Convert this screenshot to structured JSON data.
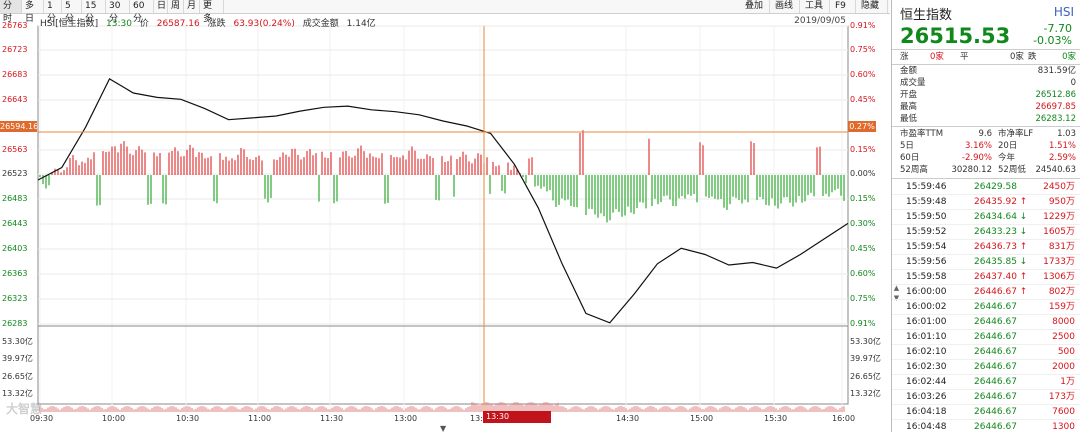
{
  "toolbar": {
    "left_buttons": [
      "分时",
      "多日",
      "1分",
      "5分",
      "15分",
      "30分",
      "60分",
      "日",
      "周",
      "月",
      "更多"
    ],
    "right_buttons": [
      "叠加",
      "画线",
      "工具",
      "F9",
      "隐藏"
    ]
  },
  "chart_header": {
    "symbol": "HSI[恒生指数]",
    "time": "13:30",
    "price_label": "价",
    "price": "26587.16",
    "change_label": "涨跌",
    "change": "63.93(0.24%)",
    "turnover_label": "成交金额",
    "turnover": "1.14亿",
    "date": "2019/09/05"
  },
  "y_axis_price": [
    "26763",
    "26723",
    "26683",
    "26643",
    "26563",
    "26523",
    "26483",
    "26443",
    "26403",
    "26363",
    "26323",
    "26283"
  ],
  "y_axis_pct": [
    "0.91%",
    "0.75%",
    "0.60%",
    "0.45%",
    "0.15%",
    "0.00%",
    "0.15%",
    "0.30%",
    "0.45%",
    "0.60%",
    "0.75%",
    "0.91%"
  ],
  "crosshair": {
    "price": "26594.16",
    "pct": "0.27%",
    "time": "13:30"
  },
  "volume_axis": [
    "53.30亿",
    "39.97亿",
    "26.65亿",
    "13.32亿"
  ],
  "x_axis": [
    "09:30",
    "10:00",
    "10:30",
    "11:00",
    "11:30",
    "13:00",
    "13:30",
    "14:30",
    "15:00",
    "15:30",
    "16:00"
  ],
  "watermark": "大智慧",
  "quote": {
    "name": "恒生指数",
    "code": "HSI",
    "price": "26515.53",
    "change": "-7.70",
    "change_pct": "-0.03%",
    "bid_ask": {
      "left_label": "涨",
      "left_value": "0家",
      "mid_label": "平",
      "right_value": "0家",
      "right_label": "跌",
      "far_value": "0家"
    },
    "stats": [
      {
        "label": "金额",
        "value": "831.59亿"
      },
      {
        "label": "成交量",
        "value": "0"
      },
      {
        "label": "开盘",
        "value": "26512.86"
      },
      {
        "label": "最高",
        "value": "26697.85"
      },
      {
        "label": "最低",
        "value": "26283.12"
      }
    ],
    "ratios": [
      {
        "l1": "市盈率TTM",
        "v1": "9.6",
        "l2": "市净率LF",
        "v2": "1.03"
      },
      {
        "l1": "5日",
        "v1": "3.16%",
        "l2": "20日",
        "v2": "1.51%"
      },
      {
        "l1": "60日",
        "v1": "-2.90%",
        "l2": "今年",
        "v2": "2.59%"
      },
      {
        "l1": "52周高",
        "v1": "30280.12",
        "l2": "52周低",
        "v2": "24540.63"
      }
    ]
  },
  "ticks": [
    {
      "time": "15:59:46",
      "price": "26429.58",
      "dir": "",
      "vol": "2450万"
    },
    {
      "time": "15:59:48",
      "price": "26435.92",
      "dir": "up",
      "vol": "950万"
    },
    {
      "time": "15:59:50",
      "price": "26434.64",
      "dir": "down",
      "vol": "1229万"
    },
    {
      "time": "15:59:52",
      "price": "26433.23",
      "dir": "down",
      "vol": "1605万"
    },
    {
      "time": "15:59:54",
      "price": "26436.73",
      "dir": "up",
      "vol": "831万"
    },
    {
      "time": "15:59:56",
      "price": "26435.85",
      "dir": "down",
      "vol": "1733万"
    },
    {
      "time": "15:59:58",
      "price": "26437.40",
      "dir": "up",
      "vol": "1306万"
    },
    {
      "time": "16:00:00",
      "price": "26446.67",
      "dir": "up",
      "vol": "802万"
    },
    {
      "time": "16:00:02",
      "price": "26446.67",
      "dir": "",
      "vol": "159万"
    },
    {
      "time": "16:01:00",
      "price": "26446.67",
      "dir": "",
      "vol": "8000"
    },
    {
      "time": "16:01:10",
      "price": "26446.67",
      "dir": "",
      "vol": "2500"
    },
    {
      "time": "16:02:10",
      "price": "26446.67",
      "dir": "",
      "vol": "500"
    },
    {
      "time": "16:02:30",
      "price": "26446.67",
      "dir": "",
      "vol": "2000"
    },
    {
      "time": "16:02:44",
      "price": "26446.67",
      "dir": "",
      "vol": "1万"
    },
    {
      "time": "16:03:26",
      "price": "26446.67",
      "dir": "",
      "vol": "173万"
    },
    {
      "time": "16:04:18",
      "price": "26446.67",
      "dir": "",
      "vol": "7600"
    },
    {
      "time": "16:04:48",
      "price": "26446.67",
      "dir": "",
      "vol": "1300"
    }
  ],
  "chart_data": {
    "type": "line",
    "title": "HSI[恒生指数]",
    "xlabel": "",
    "ylabel": "",
    "prev_close": 26523,
    "ylim": [
      26283,
      26763
    ],
    "x": [
      "09:30",
      "09:40",
      "09:50",
      "10:00",
      "10:10",
      "10:20",
      "10:30",
      "10:40",
      "10:50",
      "11:00",
      "11:10",
      "11:20",
      "11:30",
      "11:40",
      "11:50",
      "12:00",
      "13:00",
      "13:10",
      "13:20",
      "13:30",
      "13:40",
      "13:50",
      "14:00",
      "14:10",
      "14:20",
      "14:30",
      "14:40",
      "14:50",
      "15:00",
      "15:10",
      "15:20",
      "15:30",
      "15:40",
      "15:50",
      "16:00"
    ],
    "series": [
      {
        "values": [
          26515,
          26535,
          26600,
          26678,
          26655,
          26648,
          26645,
          26630,
          26612,
          26615,
          26618,
          26626,
          26632,
          26634,
          26628,
          26625,
          26620,
          26610,
          26602,
          26590,
          26540,
          26470,
          26380,
          26300,
          26285,
          26330,
          26380,
          26405,
          26395,
          26378,
          26382,
          26373,
          26395,
          26420,
          26445
        ]
      }
    ]
  }
}
